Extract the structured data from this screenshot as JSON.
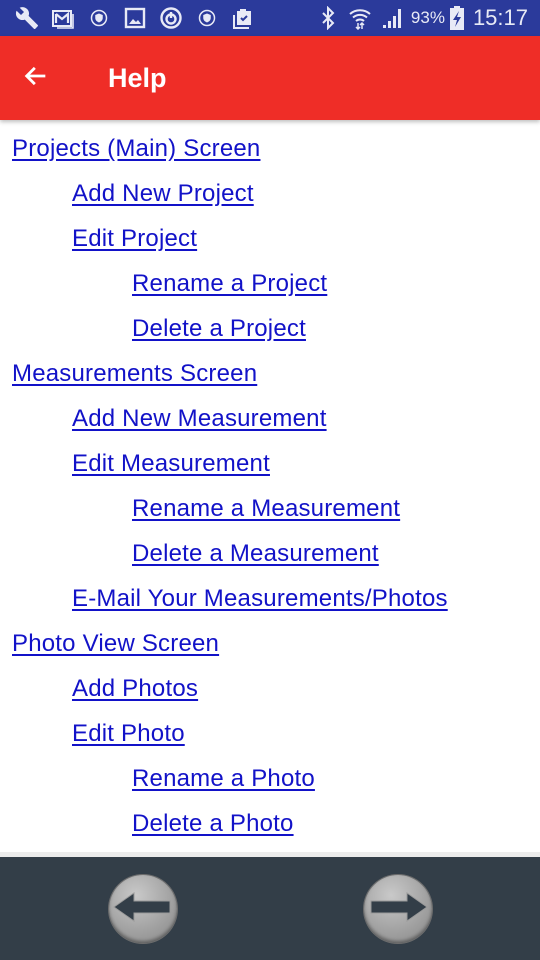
{
  "status_bar": {
    "left_icons": [
      "wrench-icon",
      "gmail-icon",
      "vpn-shield-icon",
      "gallery-icon",
      "sync-circle-icon",
      "vpn-shield-icon",
      "briefcase-check-icon"
    ],
    "right_icons": [
      "bluetooth-icon",
      "wifi-icon",
      "signal-icon",
      "battery-charging-icon"
    ],
    "battery": "93%",
    "time": "15:17"
  },
  "app_bar": {
    "back_icon": "arrow-left-icon",
    "title": "Help"
  },
  "help_links": [
    {
      "label": "Projects (Main) Screen",
      "level": 0
    },
    {
      "label": "Add New Project",
      "level": 1
    },
    {
      "label": "Edit Project",
      "level": 1
    },
    {
      "label": "Rename a Project",
      "level": 2
    },
    {
      "label": "Delete a Project",
      "level": 2
    },
    {
      "label": "Measurements Screen",
      "level": 0
    },
    {
      "label": "Add New Measurement",
      "level": 1
    },
    {
      "label": "Edit Measurement",
      "level": 1
    },
    {
      "label": "Rename a Measurement",
      "level": 2
    },
    {
      "label": "Delete a Measurement",
      "level": 2
    },
    {
      "label": "E-Mail Your Measurements/Photos",
      "level": 1
    },
    {
      "label": "Photo View Screen",
      "level": 0
    },
    {
      "label": "Add Photos",
      "level": 1
    },
    {
      "label": "Edit Photo",
      "level": 1
    },
    {
      "label": "Rename a Photo",
      "level": 2
    },
    {
      "label": "Delete a Photo",
      "level": 2
    }
  ],
  "bottom_nav": {
    "prev_icon": "arrow-left-circle-icon",
    "next_icon": "arrow-right-circle-icon"
  },
  "colors": {
    "status_bar": "#2b3a9b",
    "app_bar": "#ef2d27",
    "link": "#1212c8",
    "bottom_bar": "#333e48"
  }
}
